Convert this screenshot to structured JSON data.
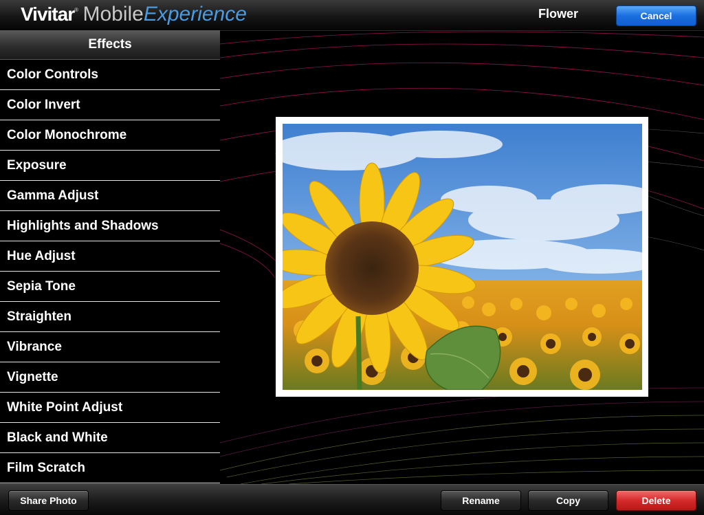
{
  "header": {
    "logo_brand": "Vivitar",
    "logo_mobile": "Mobile",
    "logo_experience": "Experience",
    "title": "Flower",
    "cancel_label": "Cancel"
  },
  "sidebar": {
    "header": "Effects",
    "items": [
      {
        "label": "Color Controls"
      },
      {
        "label": "Color Invert"
      },
      {
        "label": "Color Monochrome"
      },
      {
        "label": "Exposure"
      },
      {
        "label": "Gamma Adjust"
      },
      {
        "label": "Highlights and Shadows"
      },
      {
        "label": "Hue Adjust"
      },
      {
        "label": "Sepia Tone"
      },
      {
        "label": "Straighten"
      },
      {
        "label": "Vibrance"
      },
      {
        "label": "Vignette"
      },
      {
        "label": "White Point Adjust"
      },
      {
        "label": "Black and White"
      },
      {
        "label": "Film Scratch"
      }
    ]
  },
  "toolbar": {
    "share_label": "Share Photo",
    "rename_label": "Rename",
    "copy_label": "Copy",
    "delete_label": "Delete"
  },
  "colors": {
    "accent_blue": "#1a6fe0",
    "delete_red": "#d42a2a",
    "logo_blue": "#4a9be0"
  }
}
